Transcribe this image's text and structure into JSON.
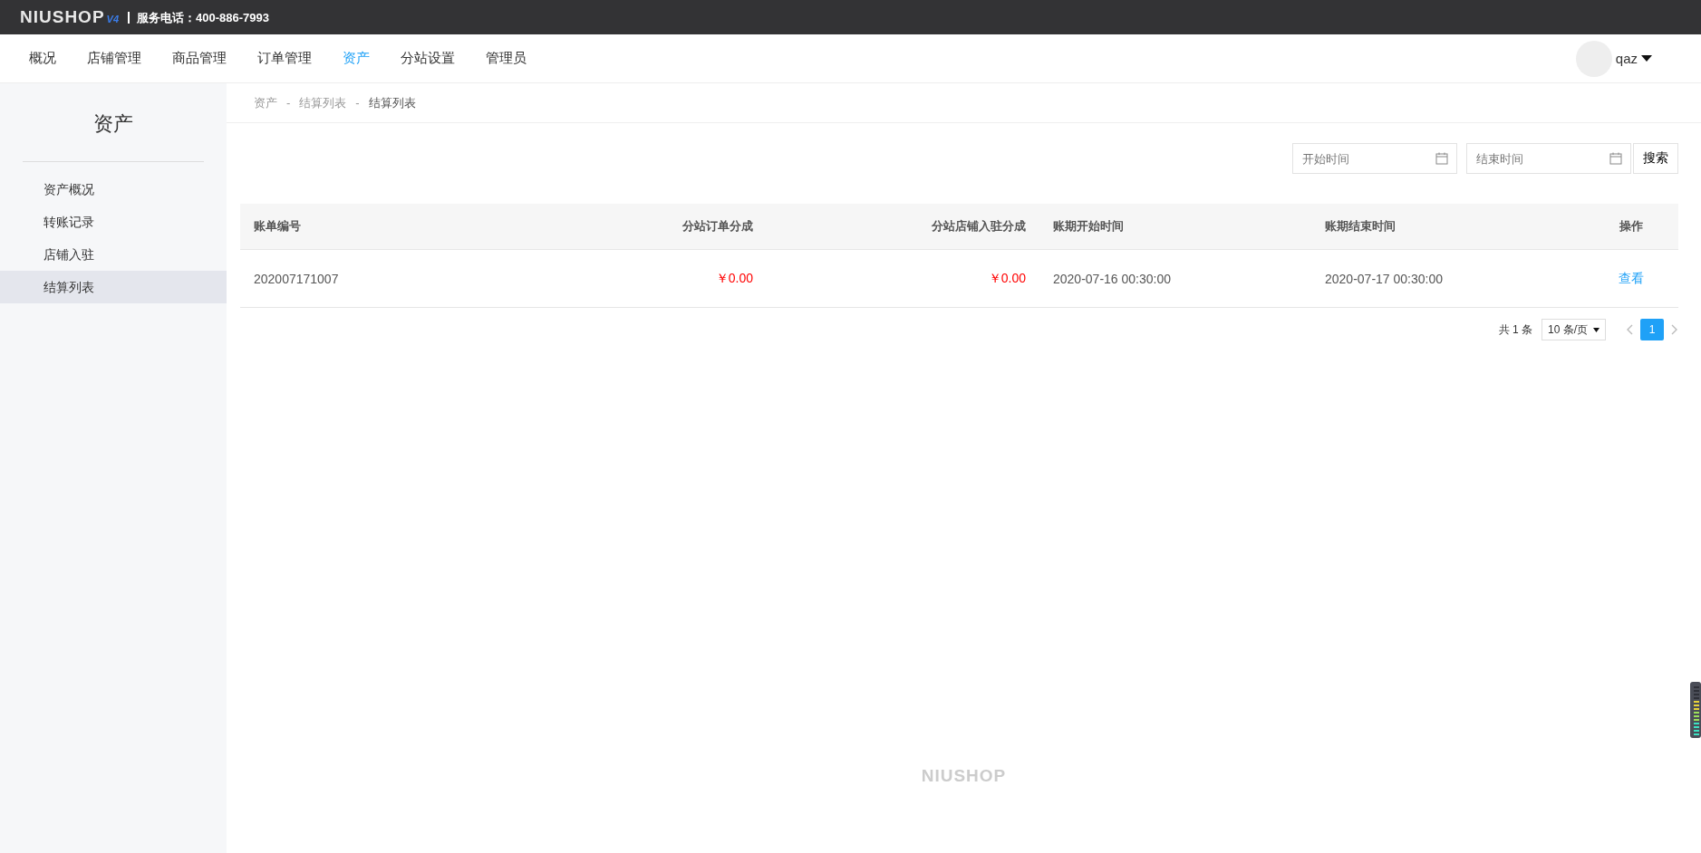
{
  "top_bar": {
    "logo": "NIUSHOP",
    "logo_version": "V4",
    "hotline": "服务电话：400-886-7993"
  },
  "nav": {
    "items": [
      {
        "label": "概况",
        "selected": false
      },
      {
        "label": "店铺管理",
        "selected": false
      },
      {
        "label": "商品管理",
        "selected": false
      },
      {
        "label": "订单管理",
        "selected": false
      },
      {
        "label": "资产",
        "selected": true
      },
      {
        "label": "分站设置",
        "selected": false
      },
      {
        "label": "管理员",
        "selected": false
      }
    ],
    "user": "qaz"
  },
  "sidebar": {
    "title": "资产",
    "items": [
      {
        "label": "资产概况",
        "selected": false
      },
      {
        "label": "转账记录",
        "selected": false
      },
      {
        "label": "店铺入驻",
        "selected": false
      },
      {
        "label": "结算列表",
        "selected": true
      }
    ]
  },
  "breadcrumb": [
    "资产",
    "结算列表",
    "结算列表"
  ],
  "breadcrumb_separator": "-",
  "filters": {
    "start": {
      "placeholder": "开始时间"
    },
    "end": {
      "placeholder": "结束时间"
    },
    "search_button": "搜索"
  },
  "table": {
    "columns": [
      "账单编号",
      "分站订单分成",
      "分站店铺入驻分成",
      "账期开始时间",
      "账期结束时间",
      "操作"
    ],
    "rows": [
      {
        "cells": [
          "202007171007",
          "￥0.00",
          "￥0.00",
          "2020-07-16 00:30:00",
          "2020-07-17 00:30:00"
        ],
        "action": "查看"
      }
    ]
  },
  "pagination": {
    "total": "共 1 条",
    "page_size": "10 条/页",
    "pages": [
      {
        "label": "1",
        "selected": true
      }
    ]
  },
  "footer_logo": "NIUSHOP"
}
